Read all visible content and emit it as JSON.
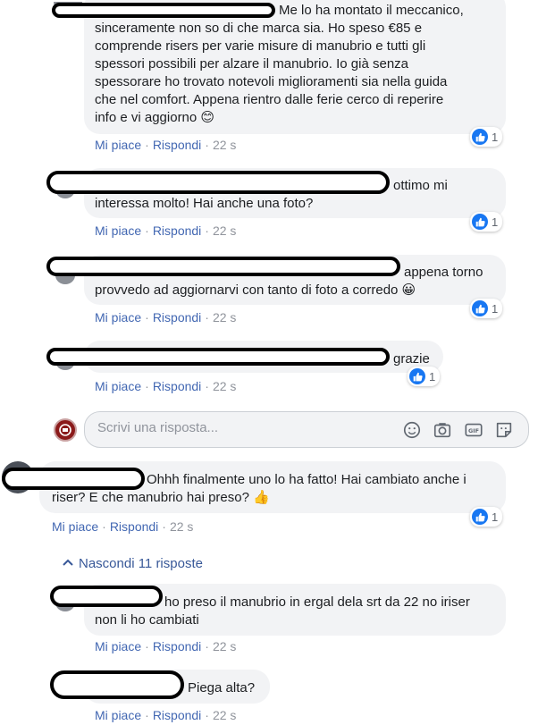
{
  "comments": [
    {
      "text_lines": [
        "Me lo ha montato il meccanico,",
        "sinceramente non so di che marca sia. Ho speso €85 e",
        "comprende risers per varie misure di manubrio e tutti gli",
        "spessori possibili per alzare il manubrio. Io già senza",
        "spessorare ho trovato notevoli miglioramenti sia nella guida",
        "che nel comfort. Appena rientro dalle ferie cerco di reperire",
        "info e vi aggiorno 😊"
      ],
      "like": "Mi piace",
      "reply": "Rispondi",
      "time": "22 s",
      "reactions": "1"
    },
    {
      "text_lines": [
        "ottimo mi",
        "interessa molto! Hai anche una foto?"
      ],
      "like": "Mi piace",
      "reply": "Rispondi",
      "time": "22 s",
      "reactions": "1"
    },
    {
      "text_lines": [
        "appena torno",
        "provvedo ad aggiornarvi con tanto di foto a corredo 😀"
      ],
      "like": "Mi piace",
      "reply": "Rispondi",
      "time": "22 s",
      "reactions": "1"
    },
    {
      "text_lines": [
        "grazie"
      ],
      "like": "Mi piace",
      "reply": "Rispondi",
      "time": "22 s",
      "reactions": "1"
    },
    {
      "text_lines": [
        "Ohhh finalmente uno lo ha fatto! Hai cambiato anche i",
        "riser? E che manubrio hai preso? 👍"
      ],
      "like": "Mi piace",
      "reply": "Rispondi",
      "time": "22 s",
      "reactions": "1"
    },
    {
      "text_lines": [
        "ho preso il manubrio in ergal dela srt da 22 no iriser",
        "non li ho cambiati"
      ],
      "like": "Mi piace",
      "reply": "Rispondi",
      "time": "22 s"
    },
    {
      "text_lines": [
        "Piega alta?"
      ],
      "like": "Mi piace",
      "reply": "Rispondi",
      "time": "22 s"
    }
  ],
  "reply_box": {
    "placeholder": "Scrivi una risposta...",
    "icons": [
      "emoji-icon",
      "camera-icon",
      "gif-icon",
      "sticker-icon"
    ]
  },
  "hide_replies": "Nascondi 11 risposte",
  "colors": {
    "link": "#4267b2",
    "bubble": "#f2f3f5",
    "like_blue": "#1877f2"
  }
}
